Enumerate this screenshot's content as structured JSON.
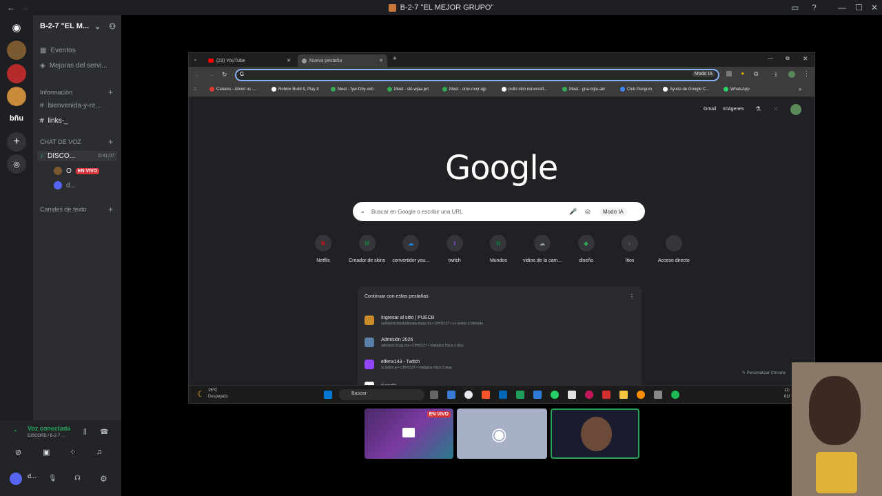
{
  "window": {
    "title": "B-2-7 \"EL MEJOR GRUPO\""
  },
  "server": {
    "name": "B-2-7 \"EL M...",
    "server_label": "bñu"
  },
  "channels": {
    "events": "Eventos",
    "improvements": "Mejoras del servi...",
    "info_category": "Información",
    "welcome": "bienvenida-y-re...",
    "links": "links-_",
    "voice_category": "CHAT DE VOZ",
    "voice_channel": "DISCO...",
    "voice_timer": "6:41:07",
    "user1": "O",
    "live_badge": "EN VIVO",
    "user2": "d...",
    "text_category": "Canales de texto"
  },
  "voice": {
    "status": "Voz conectada",
    "channel": "DISCORD / B-2-7 ...",
    "user": "d..."
  },
  "browser": {
    "tabs": [
      {
        "label": "(23) YouTube"
      },
      {
        "label": "Nueva pestaña"
      }
    ],
    "ai_mode": "Modo IA",
    "bookmarks": [
      {
        "label": "Careers - About us -...",
        "color": "#e53935"
      },
      {
        "label": "Roblox Build It, Play It",
        "color": "#ffffff"
      },
      {
        "label": "Meet - fyw-fzby-xvb",
        "color": "#34a853"
      },
      {
        "label": "Meet - skt-wjaa-jwt",
        "color": "#34a853"
      },
      {
        "label": "Meet - omv-mojr-ojp",
        "color": "#34a853"
      },
      {
        "label": "pollo skin minecraft...",
        "color": "#ffffff"
      },
      {
        "label": "Meet - gna-mjtu-akr",
        "color": "#34a853"
      },
      {
        "label": "Club Penguin",
        "color": "#4285f4"
      },
      {
        "label": "Ayuda de Google C...",
        "color": "#ffffff"
      },
      {
        "label": "WhatsApp",
        "color": "#25d366"
      }
    ],
    "gmail": "Gmail",
    "images": "Imágenes",
    "logo": "Google",
    "search_placeholder": "Buscar en Google o escribir una URL",
    "search_ai": "Modo IA",
    "shortcuts": [
      {
        "label": "Netflis",
        "glyph": "N",
        "color": "#e50914"
      },
      {
        "label": "Creador de skins",
        "glyph": "M",
        "color": "#188038"
      },
      {
        "label": "convertidor you...",
        "glyph": "☁",
        "color": "#1e88e5"
      },
      {
        "label": "twitch",
        "glyph": "t",
        "color": "#9146ff"
      },
      {
        "label": "Mundos",
        "glyph": "N",
        "color": "#0b8043"
      },
      {
        "label": "vidios de la cam...",
        "glyph": "☁",
        "color": "#9aa0a6"
      },
      {
        "label": "diseño",
        "glyph": "◆",
        "color": "#34a853"
      },
      {
        "label": "litos",
        "glyph": "◐",
        "color": "#5f6368"
      },
      {
        "label": "Acceso directo",
        "glyph": "+",
        "color": "#35363a"
      }
    ],
    "continue_title": "Continuar con estas pestañas",
    "continue_items": [
      {
        "title": "Ingresar al sitio | PUECB",
        "sub": "autoservicioestudiantes.buap.mx • CPH2127 • Lo visitas a menudo",
        "color": "#c98b2a"
      },
      {
        "title": "Admisión 2026",
        "sub": "admision.buap.mx • CPH2127 • Visitados Hace 2 días",
        "color": "#5a7fa8"
      },
      {
        "title": "elfenx143 - Twitch",
        "sub": "m.twitch.tv • CPH2127 • Visitados Hace 2 días",
        "color": "#9146ff"
      },
      {
        "title": "Google",
        "sub": "",
        "color": "#ffffff"
      }
    ],
    "customize": "Personalizar Chrome"
  },
  "taskbar": {
    "temp": "15°C",
    "weather": "Despejado",
    "search": "Buscar",
    "time": "12:",
    "date": "01/"
  },
  "stream_tiles": {
    "live": "EN VIVO"
  }
}
